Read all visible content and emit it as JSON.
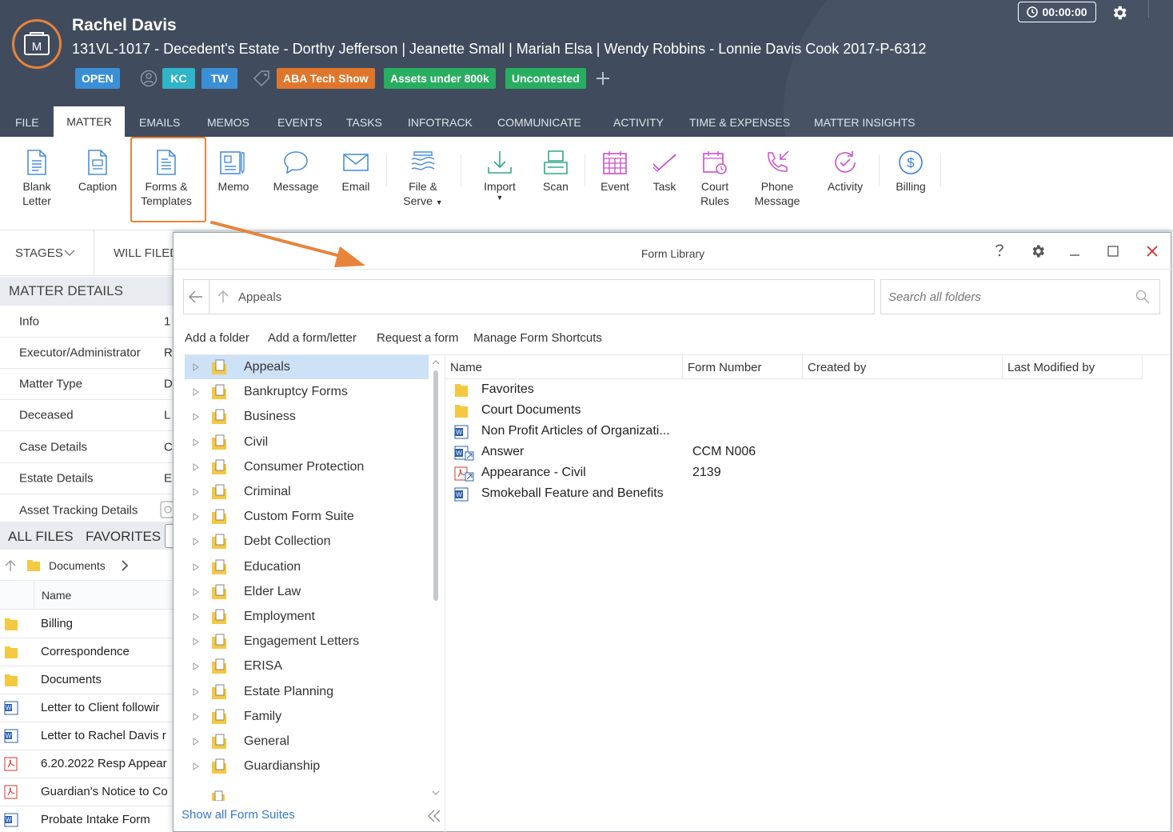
{
  "header": {
    "client_name": "Rachel Davis",
    "matter_title": "131VL-1017 - Decedent's Estate - Dorthy Jefferson | Jeanette Small | Mariah Elsa | Wendy Robbins - Lonnie Davis Cook 2017-P-6312",
    "status": "OPEN",
    "staff": [
      "KC",
      "TW"
    ],
    "tags": [
      "ABA Tech Show",
      "Assets under 800k",
      "Uncontested"
    ],
    "timer": "00:00:00",
    "colors": {
      "accent": "#e8833a",
      "open": "#3b8fd6",
      "staff": "#2fb4c8",
      "tag_orange": "#e0762b",
      "tag_green": "#27ae60",
      "header_bg": "#404c5d"
    }
  },
  "tabs": [
    "FILE",
    "MATTER",
    "EMAILS",
    "MEMOS",
    "EVENTS",
    "TASKS",
    "INFOTRACK",
    "COMMUNICATE",
    "ACTIVITY",
    "TIME & EXPENSES",
    "MATTER INSIGHTS"
  ],
  "ribbon": {
    "blank_letter": [
      "Blank",
      "Letter"
    ],
    "caption": "Caption",
    "forms_templates": [
      "Forms &",
      "Templates"
    ],
    "memo": "Memo",
    "message": "Message",
    "email": "Email",
    "file_serve": [
      "File &",
      "Serve"
    ],
    "import": "Import",
    "scan": "Scan",
    "event": "Event",
    "task": "Task",
    "court_rules": [
      "Court",
      "Rules"
    ],
    "phone_message": [
      "Phone",
      "Message"
    ],
    "activity": "Activity",
    "billing": "Billing"
  },
  "left_panel": {
    "stages": "STAGES",
    "will_filed": "WILL FILED",
    "matter_details": "MATTER DETAILS",
    "details": [
      {
        "label": "Info",
        "value": "1"
      },
      {
        "label": "Executor/Administrator",
        "value": "R"
      },
      {
        "label": "Matter Type",
        "value": "D"
      },
      {
        "label": "Deceased",
        "value": "L"
      },
      {
        "label": "Case Details",
        "value": "C"
      },
      {
        "label": "Estate Details",
        "value": "E"
      },
      {
        "label": "Asset Tracking Details",
        "value": ""
      }
    ],
    "all_files": "ALL FILES",
    "favorites": "FAVORITES",
    "breadcrumb": "Documents",
    "name_header": "Name",
    "files": [
      {
        "name": "Billing",
        "type": "folder"
      },
      {
        "name": "Correspondence",
        "type": "folder"
      },
      {
        "name": "Documents",
        "type": "folder"
      },
      {
        "name": "Letter to Client followir",
        "type": "word"
      },
      {
        "name": "Letter to Rachel Davis r",
        "type": "word"
      },
      {
        "name": "6.20.2022 Resp Appear",
        "type": "pdf"
      },
      {
        "name": "Guardian's Notice to Co",
        "type": "pdf"
      },
      {
        "name": "Probate Intake Form",
        "type": "word"
      }
    ]
  },
  "dialog": {
    "title": "Form Library",
    "path": "Appeals",
    "search_placeholder": "Search all folders",
    "actions": [
      "Add a folder",
      "Add a form/letter",
      "Request a form",
      "Manage Form Shortcuts"
    ],
    "tree": [
      "Appeals",
      "Bankruptcy Forms",
      "Business",
      "Civil",
      "Consumer Protection",
      "Criminal",
      "Custom Form Suite",
      "Debt Collection",
      "Education",
      "Elder Law",
      "Employment",
      "Engagement Letters",
      "ERISA",
      "Estate Planning",
      "Family",
      "General",
      "Guardianship"
    ],
    "show_all": "Show all Form Suites",
    "columns": [
      "Name",
      "Form Number",
      "Created by",
      "Last Modified by"
    ],
    "items": [
      {
        "name": "Favorites",
        "number": "",
        "type": "folder"
      },
      {
        "name": "Court Documents",
        "number": "",
        "type": "folder"
      },
      {
        "name": "Non Profit Articles of Organizati...",
        "number": "",
        "type": "word"
      },
      {
        "name": "Answer",
        "number": "CCM N006",
        "type": "word-link"
      },
      {
        "name": "Appearance - Civil",
        "number": "2139",
        "type": "pdf-link"
      },
      {
        "name": "Smokeball Feature and Benefits",
        "number": "",
        "type": "word"
      }
    ]
  }
}
